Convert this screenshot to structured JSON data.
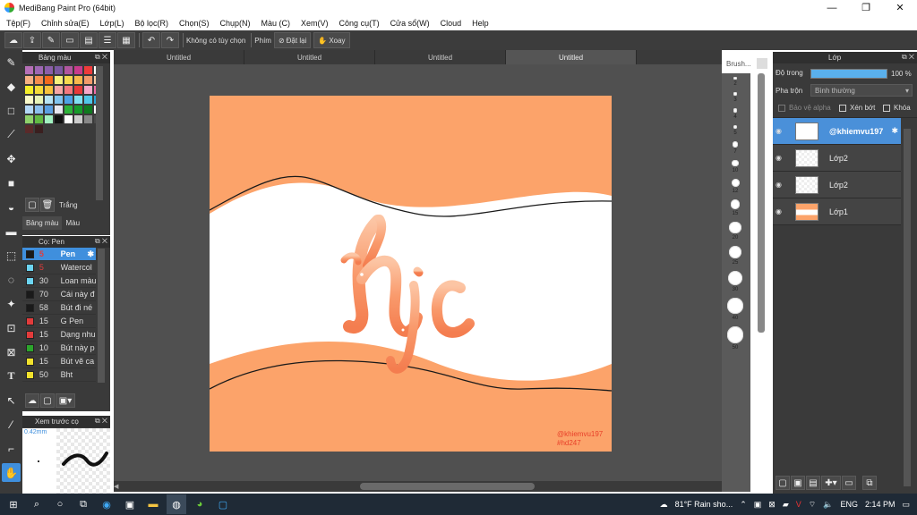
{
  "app": {
    "title": "MediBang Paint Pro (64bit)"
  },
  "window": {
    "minimize": "—",
    "maximize": "❐",
    "close": "✕"
  },
  "menu": [
    "Tệp(F)",
    "Chỉnh sửa(E)",
    "Lớp(L)",
    "Bộ lọc(R)",
    "Chọn(S)",
    "Chụp(N)",
    "Màu (C)",
    "Xem(V)",
    "Công cụ(T)",
    "Cửa sổ(W)",
    "Cloud",
    "Help"
  ],
  "toolbar": {
    "no_option": "Không có tùy chọn",
    "keys_label": "Phím",
    "reset_label": "Đặt lại",
    "rotate_label": "Xoay"
  },
  "palette_panel": {
    "title": "Bảng màu",
    "color_name": "Trắng",
    "tab_palette": "Bảng màu",
    "tab_color": "Màu",
    "swatches": [
      "#b56fb7",
      "#9d67b3",
      "#8b5ea9",
      "#7b59a0",
      "#b1569f",
      "#c83b8c",
      "#ef3b3b",
      "#ffffff",
      "#f5b183",
      "#f58d4e",
      "#f26a1d",
      "#f7f27c",
      "#f5d94f",
      "#f7b84d",
      "#f49a6a",
      "#f8cba6",
      "#f4ee2a",
      "#f5dc3a",
      "#f8c23d",
      "#f7a6a6",
      "#f3787e",
      "#e73a3a",
      "#f8a7c9",
      "#f06ea8",
      "#f9f9c9",
      "#e8f4b8",
      "#b7e4f5",
      "#7fc4ef",
      "#4ea3e6",
      "#80e0f0",
      "#50c7e8",
      "#2aa7d9",
      "#b3d7f5",
      "#8cc0ef",
      "#5a9fe2",
      "#e8e8f0",
      "#2db33a",
      "#179b2a",
      "#0f7a1e",
      "#ffffff",
      "#8ed16b",
      "#61b944",
      "#a2f2c1",
      "#111111",
      "#ffffff",
      "#cccccc",
      "#888888",
      "#4a4a4a",
      "#5a2a2a",
      "#3a1f1f"
    ]
  },
  "brush_panel": {
    "title": "Cọ: Pen",
    "items": [
      {
        "size": "5",
        "name": "Pen",
        "color": "#1a1a1a"
      },
      {
        "size": "5",
        "name": "Watercol",
        "color": "#6cd5f2"
      },
      {
        "size": "30",
        "name": "Loan màu",
        "color": "#6cd5f2"
      },
      {
        "size": "70",
        "name": "Cái này đ",
        "color": "#1a1a1a"
      },
      {
        "size": "58",
        "name": "Bút đi né",
        "color": "#1a1a1a"
      },
      {
        "size": "15",
        "name": "G Pen",
        "color": "#e23b3b"
      },
      {
        "size": "15",
        "name": "Dạng nhu",
        "color": "#e23b3b"
      },
      {
        "size": "10",
        "name": "Bút này p",
        "color": "#2ca52c"
      },
      {
        "size": "15",
        "name": "Bút vẽ ca",
        "color": "#f2e22c"
      },
      {
        "size": "50",
        "name": "Bht",
        "color": "#f2e22c"
      }
    ]
  },
  "preview_panel": {
    "title": "Xem trước cọ",
    "size": "0.42mm"
  },
  "tabs": [
    "Untitled",
    "Untitled",
    "Untitled",
    "Untitled"
  ],
  "canvas": {
    "text": "hjc",
    "credit1": "@khiemvu197",
    "credit2": "#hd247"
  },
  "brushsize_panel": {
    "title": "Brush...",
    "sizes": [
      "2",
      "3",
      "4",
      "5",
      "7",
      "10",
      "12",
      "15",
      "20",
      "25",
      "30",
      "40",
      "50"
    ]
  },
  "layer_panel": {
    "title": "Lớp",
    "opacity_label": "Độ trong",
    "opacity_value": "100 %",
    "blend_label": "Pha trộn",
    "blend_value": "Bình thường",
    "protect_alpha": "Bảo vệ alpha",
    "clipping": "Xén bớt",
    "lock": "Khóa",
    "layers": [
      {
        "name": "@khiemvu197",
        "selected": true
      },
      {
        "name": "Lớp2",
        "selected": false
      },
      {
        "name": "Lớp2",
        "selected": false
      },
      {
        "name": "Lớp1",
        "selected": false
      }
    ]
  },
  "taskbar": {
    "weather": "81°F Rain sho...",
    "language": "ENG",
    "time": "2:14 PM"
  },
  "colors": {
    "accent": "#3f8fdd",
    "canvas_orange": "#fca36a",
    "canvas_white": "#ffffff"
  }
}
